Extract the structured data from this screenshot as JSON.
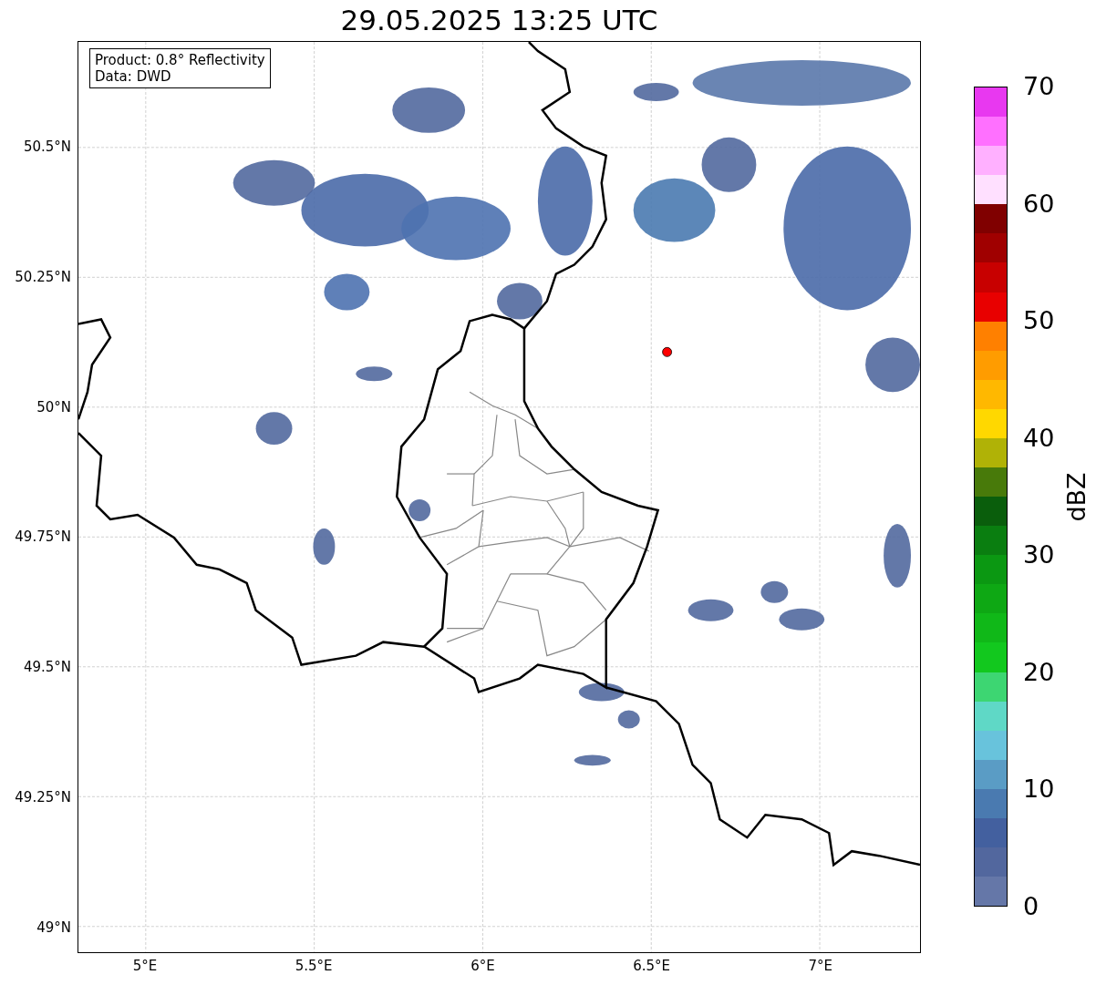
{
  "title": "29.05.2025 13:25 UTC",
  "info_box": [
    "Product: 0.8° Reflectivity",
    "Data: DWD"
  ],
  "map": {
    "x_ticks": [
      "5°E",
      "5.5°E",
      "6°E",
      "6.5°E",
      "7°E"
    ],
    "y_ticks": [
      "50.5°N",
      "50.25°N",
      "50°N",
      "49.75°N",
      "49.5°N",
      "49.25°N",
      "49°N"
    ]
  },
  "colorbar": {
    "label": "dBZ",
    "ticks": [
      "70",
      "60",
      "50",
      "40",
      "30",
      "20",
      "10",
      "0"
    ],
    "bands": [
      {
        "color": "#e838f0"
      },
      {
        "color": "#ff70ff"
      },
      {
        "color": "#ffb0ff"
      },
      {
        "color": "#ffe0ff"
      },
      {
        "color": "#800000"
      },
      {
        "color": "#a00000"
      },
      {
        "color": "#c80000"
      },
      {
        "color": "#e80000"
      },
      {
        "color": "#ff8000"
      },
      {
        "color": "#ff9c00"
      },
      {
        "color": "#ffb800"
      },
      {
        "color": "#ffd800"
      },
      {
        "color": "#b0b206"
      },
      {
        "color": "#487a0a"
      },
      {
        "color": "#0a5e0c"
      },
      {
        "color": "#0a7e10"
      },
      {
        "color": "#0b9812"
      },
      {
        "color": "#0ea814"
      },
      {
        "color": "#10b818"
      },
      {
        "color": "#12c81e"
      },
      {
        "color": "#3dd672"
      },
      {
        "color": "#5fd8c6"
      },
      {
        "color": "#68c3dc"
      },
      {
        "color": "#5a9cc5"
      },
      {
        "color": "#4a7ab0"
      },
      {
        "color": "#43609f"
      },
      {
        "color": "#52679e"
      },
      {
        "color": "#6577a8"
      }
    ]
  }
}
